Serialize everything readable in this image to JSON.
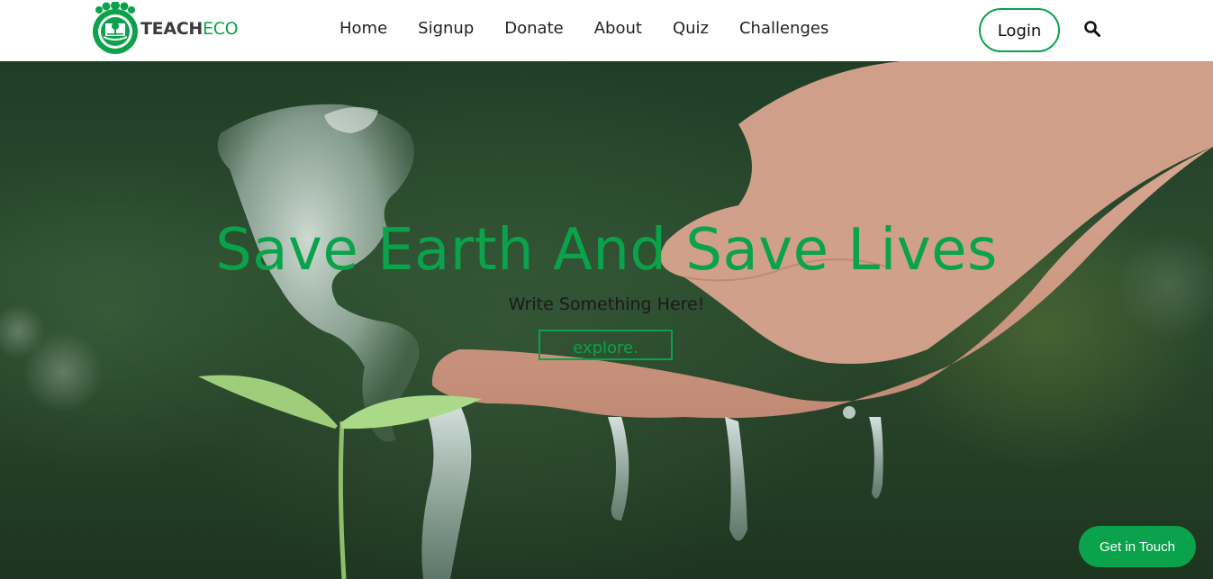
{
  "brand": {
    "name_part1": "TEACH",
    "name_part2": "ECO",
    "logo_icon": "tree-book-logo-icon"
  },
  "nav": {
    "links": [
      {
        "label": "Home"
      },
      {
        "label": "Signup"
      },
      {
        "label": "Donate"
      },
      {
        "label": "About"
      },
      {
        "label": "Quiz"
      },
      {
        "label": "Challenges"
      }
    ],
    "login_label": "Login",
    "search_icon": "search-icon"
  },
  "hero": {
    "title": "Save Earth And Save Lives",
    "subtitle": "Write Something Here!",
    "explore_label": "explore.",
    "background": "photo-hand-water-globe-sprout"
  },
  "floating": {
    "get_in_touch_label": "Get in Touch"
  },
  "colors": {
    "accent": "#0aa24a",
    "nav_bg": "#ffffff",
    "text_dark": "#222222"
  }
}
